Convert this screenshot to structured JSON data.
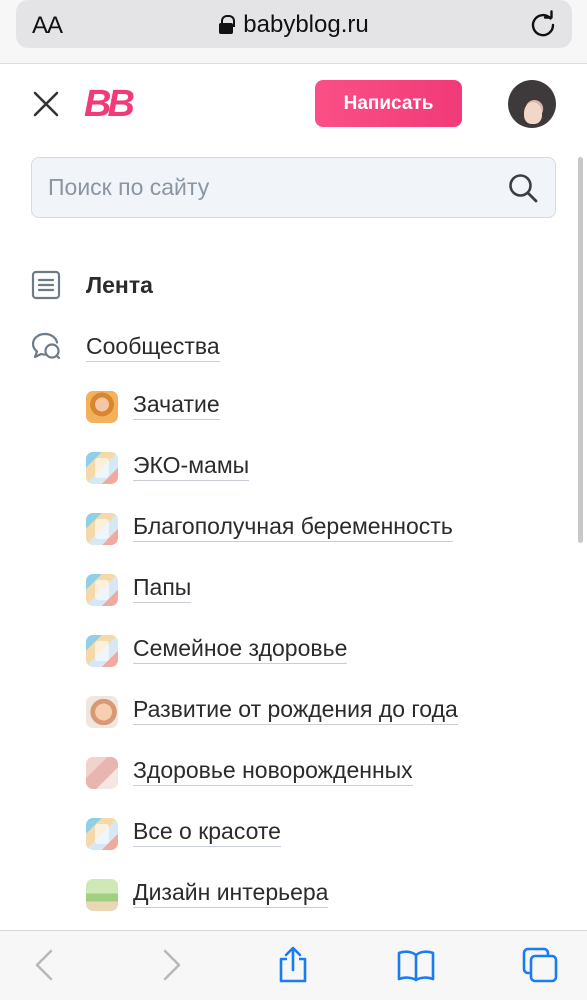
{
  "browser": {
    "text_size_label": "AA",
    "url": "babyblog.ru",
    "icons": {
      "lock": "lock-icon",
      "reload": "reload-icon",
      "back": "chevron-left-icon",
      "forward": "chevron-right-icon",
      "share": "share-icon",
      "bookmarks": "book-icon",
      "tabs": "tabs-icon"
    }
  },
  "header": {
    "logo": "BB",
    "write_button": "Написать",
    "accent_color": "#f13a78"
  },
  "search": {
    "placeholder": "Поиск по сайту",
    "value": ""
  },
  "menu": {
    "feed": {
      "label": "Лента",
      "icon": "feed-icon"
    },
    "communities": {
      "label": "Сообщества",
      "icon": "chat-bubbles-icon"
    }
  },
  "communities": [
    {
      "label": "Зачатие"
    },
    {
      "label": "ЭКО-мамы"
    },
    {
      "label": "Благополучная беременность"
    },
    {
      "label": "Папы"
    },
    {
      "label": "Семейное здоровье"
    },
    {
      "label": "Развитие от рождения до года"
    },
    {
      "label": "Здоровье новорожденных"
    },
    {
      "label": "Все о красоте"
    },
    {
      "label": "Дизайн интерьера"
    }
  ]
}
